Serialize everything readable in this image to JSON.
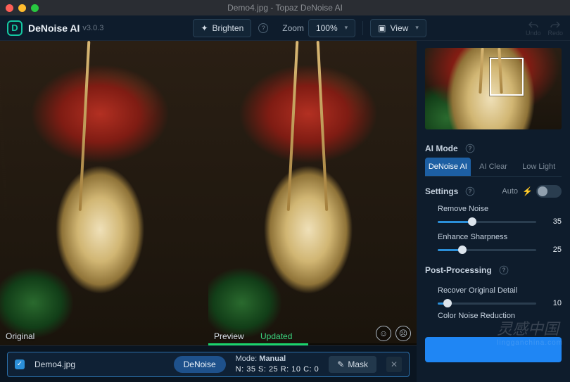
{
  "titlebar": {
    "title": "Demo4.jpg - Topaz DeNoise AI"
  },
  "header": {
    "logo_letter": "D",
    "app_name": "DeNoise AI",
    "version": "v3.0.3",
    "brighten": "Brighten",
    "zoom_label": "Zoom",
    "zoom_value": "100%",
    "view": "View",
    "undo": "Undo",
    "redo": "Redo"
  },
  "viewer": {
    "original_label": "Original",
    "preview_label": "Preview",
    "updated_label": "Updated"
  },
  "filebar": {
    "filename": "Demo4.jpg",
    "pill": "DeNoise",
    "mode_label": "Mode:",
    "mode_value": "Manual",
    "params": "N: 35  S: 25  R: 10  C: 0",
    "mask": "Mask"
  },
  "panel": {
    "ai_mode": "AI Mode",
    "tabs": [
      "DeNoise AI",
      "AI Clear",
      "Low Light"
    ],
    "settings": "Settings",
    "auto": "Auto",
    "remove_noise": {
      "label": "Remove Noise",
      "value": 35
    },
    "enhance_sharp": {
      "label": "Enhance Sharpness",
      "value": 25
    },
    "post_processing": "Post-Processing",
    "recover_detail": {
      "label": "Recover Original Detail",
      "value": 10
    },
    "color_noise": {
      "label": "Color Noise Reduction"
    }
  },
  "watermark": {
    "main": "灵感中国",
    "sub": "lingganchina.com"
  }
}
